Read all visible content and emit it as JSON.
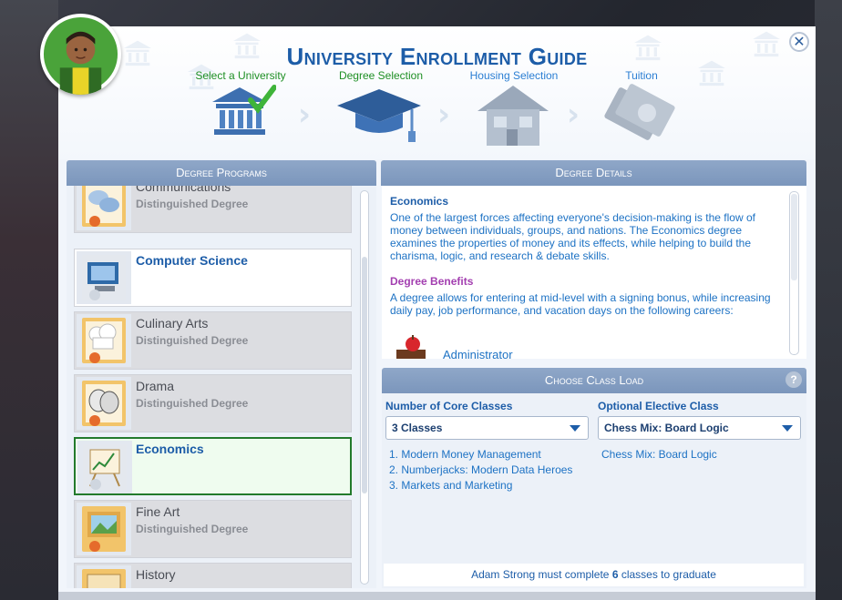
{
  "title": "University Enrollment Guide",
  "steps": [
    {
      "label": "Select a University",
      "status": "done"
    },
    {
      "label": "Degree Selection",
      "status": "current"
    },
    {
      "label": "Housing Selection",
      "status": "todo"
    },
    {
      "label": "Tuition",
      "status": "todo"
    }
  ],
  "close_symbol": "✕",
  "left_panel": {
    "header": "Degree Programs",
    "degrees": [
      {
        "name": "Communications",
        "subtitle": "Distinguished Degree",
        "icon": "speech-bubbles-icon",
        "state": "normal"
      },
      {
        "name": "Computer Science",
        "subtitle": "",
        "icon": "computer-icon",
        "state": "white"
      },
      {
        "name": "Culinary Arts",
        "subtitle": "Distinguished Degree",
        "icon": "chef-hat-icon",
        "state": "normal"
      },
      {
        "name": "Drama",
        "subtitle": "Distinguished Degree",
        "icon": "theater-masks-icon",
        "state": "normal"
      },
      {
        "name": "Economics",
        "subtitle": "",
        "icon": "easel-chart-icon",
        "state": "selected"
      },
      {
        "name": "Fine Art",
        "subtitle": "Distinguished Degree",
        "icon": "painting-icon",
        "state": "normal"
      },
      {
        "name": "History",
        "subtitle": "",
        "icon": "scroll-icon",
        "state": "normal"
      }
    ]
  },
  "details": {
    "header": "Degree Details",
    "degree_title": "Economics",
    "description": "One of the largest forces affecting everyone's decision-making is the flow of money between individuals, groups, and nations. The Economics degree examines the properties of money and its effects, while helping to build the charisma, logic, and research & debate skills.",
    "benefits_title": "Degree Benefits",
    "benefits_text": "A degree allows for entering at mid-level with a signing bonus, while increasing daily pay, job performance, and vacation days on the following careers:",
    "career_preview": "Administrator"
  },
  "class_load": {
    "header": "Choose Class Load",
    "help_symbol": "?",
    "core_label": "Number of Core Classes",
    "core_value": "3 Classes",
    "elective_label": "Optional Elective Class",
    "elective_value": "Chess Mix: Board Logic",
    "core_classes": [
      "1.  Modern Money Management",
      "2.  Numberjacks: Modern Data Heroes",
      "3.  Markets and Marketing"
    ],
    "elective_class": "Chess Mix: Board Logic",
    "footer_prefix": "Adam Strong must complete ",
    "footer_count": "6",
    "footer_suffix": " classes to graduate"
  },
  "colors": {
    "accent_blue": "#1d5da8",
    "done_green": "#1e8f24",
    "header_blue": "#7b96bc",
    "selected_border": "#237a2c"
  }
}
